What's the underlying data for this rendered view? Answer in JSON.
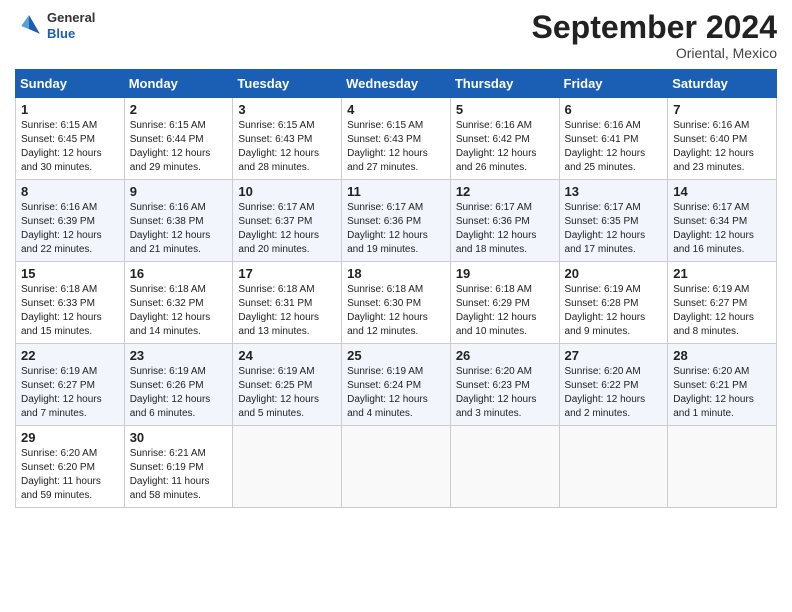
{
  "header": {
    "logo_general": "General",
    "logo_blue": "Blue",
    "month_title": "September 2024",
    "location": "Oriental, Mexico"
  },
  "days_of_week": [
    "Sunday",
    "Monday",
    "Tuesday",
    "Wednesday",
    "Thursday",
    "Friday",
    "Saturday"
  ],
  "weeks": [
    [
      {
        "day": "1",
        "sunrise": "6:15 AM",
        "sunset": "6:45 PM",
        "daylight": "12 hours and 30 minutes."
      },
      {
        "day": "2",
        "sunrise": "6:15 AM",
        "sunset": "6:44 PM",
        "daylight": "12 hours and 29 minutes."
      },
      {
        "day": "3",
        "sunrise": "6:15 AM",
        "sunset": "6:43 PM",
        "daylight": "12 hours and 28 minutes."
      },
      {
        "day": "4",
        "sunrise": "6:15 AM",
        "sunset": "6:43 PM",
        "daylight": "12 hours and 27 minutes."
      },
      {
        "day": "5",
        "sunrise": "6:16 AM",
        "sunset": "6:42 PM",
        "daylight": "12 hours and 26 minutes."
      },
      {
        "day": "6",
        "sunrise": "6:16 AM",
        "sunset": "6:41 PM",
        "daylight": "12 hours and 25 minutes."
      },
      {
        "day": "7",
        "sunrise": "6:16 AM",
        "sunset": "6:40 PM",
        "daylight": "12 hours and 23 minutes."
      }
    ],
    [
      {
        "day": "8",
        "sunrise": "6:16 AM",
        "sunset": "6:39 PM",
        "daylight": "12 hours and 22 minutes."
      },
      {
        "day": "9",
        "sunrise": "6:16 AM",
        "sunset": "6:38 PM",
        "daylight": "12 hours and 21 minutes."
      },
      {
        "day": "10",
        "sunrise": "6:17 AM",
        "sunset": "6:37 PM",
        "daylight": "12 hours and 20 minutes."
      },
      {
        "day": "11",
        "sunrise": "6:17 AM",
        "sunset": "6:36 PM",
        "daylight": "12 hours and 19 minutes."
      },
      {
        "day": "12",
        "sunrise": "6:17 AM",
        "sunset": "6:36 PM",
        "daylight": "12 hours and 18 minutes."
      },
      {
        "day": "13",
        "sunrise": "6:17 AM",
        "sunset": "6:35 PM",
        "daylight": "12 hours and 17 minutes."
      },
      {
        "day": "14",
        "sunrise": "6:17 AM",
        "sunset": "6:34 PM",
        "daylight": "12 hours and 16 minutes."
      }
    ],
    [
      {
        "day": "15",
        "sunrise": "6:18 AM",
        "sunset": "6:33 PM",
        "daylight": "12 hours and 15 minutes."
      },
      {
        "day": "16",
        "sunrise": "6:18 AM",
        "sunset": "6:32 PM",
        "daylight": "12 hours and 14 minutes."
      },
      {
        "day": "17",
        "sunrise": "6:18 AM",
        "sunset": "6:31 PM",
        "daylight": "12 hours and 13 minutes."
      },
      {
        "day": "18",
        "sunrise": "6:18 AM",
        "sunset": "6:30 PM",
        "daylight": "12 hours and 12 minutes."
      },
      {
        "day": "19",
        "sunrise": "6:18 AM",
        "sunset": "6:29 PM",
        "daylight": "12 hours and 10 minutes."
      },
      {
        "day": "20",
        "sunrise": "6:19 AM",
        "sunset": "6:28 PM",
        "daylight": "12 hours and 9 minutes."
      },
      {
        "day": "21",
        "sunrise": "6:19 AM",
        "sunset": "6:27 PM",
        "daylight": "12 hours and 8 minutes."
      }
    ],
    [
      {
        "day": "22",
        "sunrise": "6:19 AM",
        "sunset": "6:27 PM",
        "daylight": "12 hours and 7 minutes."
      },
      {
        "day": "23",
        "sunrise": "6:19 AM",
        "sunset": "6:26 PM",
        "daylight": "12 hours and 6 minutes."
      },
      {
        "day": "24",
        "sunrise": "6:19 AM",
        "sunset": "6:25 PM",
        "daylight": "12 hours and 5 minutes."
      },
      {
        "day": "25",
        "sunrise": "6:19 AM",
        "sunset": "6:24 PM",
        "daylight": "12 hours and 4 minutes."
      },
      {
        "day": "26",
        "sunrise": "6:20 AM",
        "sunset": "6:23 PM",
        "daylight": "12 hours and 3 minutes."
      },
      {
        "day": "27",
        "sunrise": "6:20 AM",
        "sunset": "6:22 PM",
        "daylight": "12 hours and 2 minutes."
      },
      {
        "day": "28",
        "sunrise": "6:20 AM",
        "sunset": "6:21 PM",
        "daylight": "12 hours and 1 minute."
      }
    ],
    [
      {
        "day": "29",
        "sunrise": "6:20 AM",
        "sunset": "6:20 PM",
        "daylight": "11 hours and 59 minutes."
      },
      {
        "day": "30",
        "sunrise": "6:21 AM",
        "sunset": "6:19 PM",
        "daylight": "11 hours and 58 minutes."
      },
      null,
      null,
      null,
      null,
      null
    ]
  ],
  "labels": {
    "sunrise": "Sunrise:",
    "sunset": "Sunset:",
    "daylight": "Daylight:"
  }
}
